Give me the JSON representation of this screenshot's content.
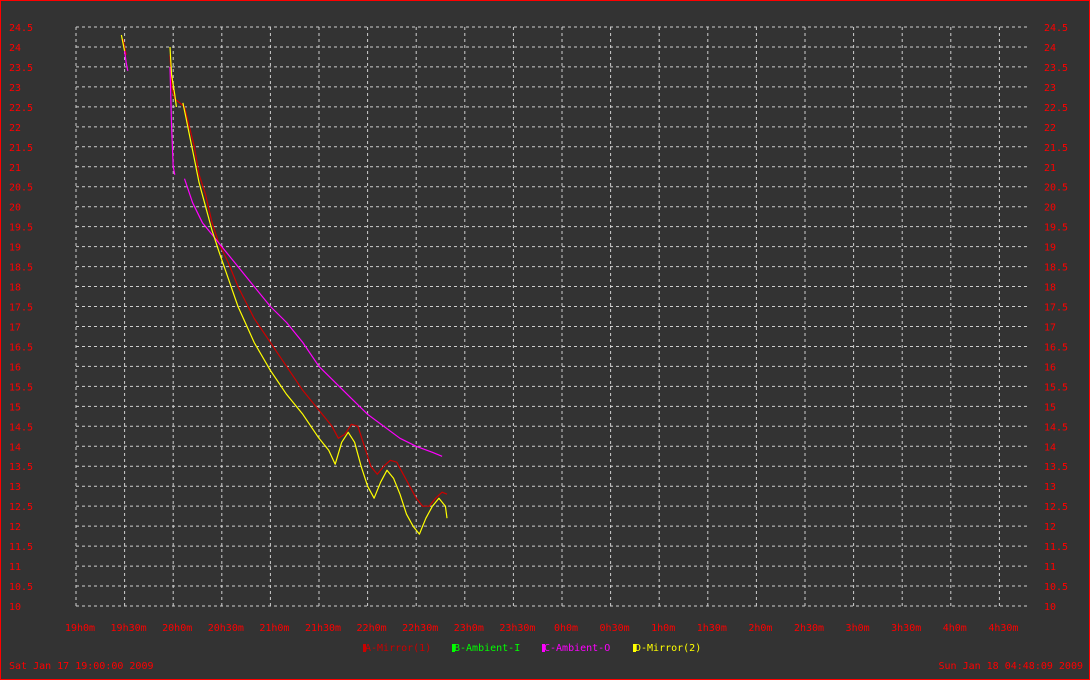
{
  "chart_data": {
    "type": "line",
    "y_ticks": [
      "24.5",
      "24",
      "23.5",
      "23",
      "22.5",
      "22",
      "21.5",
      "21",
      "20.5",
      "20",
      "19.5",
      "19",
      "18.5",
      "18",
      "17.5",
      "17",
      "16.5",
      "16",
      "15.5",
      "15",
      "14.5",
      "14",
      "13.5",
      "13",
      "12.5",
      "12",
      "11.5",
      "11",
      "10.5",
      "10"
    ],
    "x_ticks": [
      "19h0m",
      "19h30m",
      "20h0m",
      "20h30m",
      "21h0m",
      "21h30m",
      "22h0m",
      "22h30m",
      "23h0m",
      "23h30m",
      "0h0m",
      "0h30m",
      "1h0m",
      "1h30m",
      "2h0m",
      "2h30m",
      "3h0m",
      "3h30m",
      "4h0m",
      "4h30m"
    ],
    "ylim": [
      10,
      24.5
    ],
    "xlim_minutes": [
      0,
      588
    ],
    "x_unit": "minutes after Sat Jan 17 19:00:00 2009",
    "grid": true,
    "legend_position": "bottom-center",
    "start_label": "Sat Jan 17 19:00:00 2009",
    "end_label": "Sun Jan 18 04:48:09 2009",
    "series": [
      {
        "name": "A-Mirror(1)",
        "color": "#cc0000",
        "segments": [
          [
            [
              29,
              24.2
            ],
            [
              30,
              24.0
            ],
            [
              31,
              23.8
            ]
          ],
          [
            [
              58,
              23.8
            ],
            [
              59,
              23.0
            ],
            [
              61,
              22.7
            ],
            [
              64,
              22.6
            ],
            [
              67,
              22.5
            ],
            [
              70,
              22.0
            ],
            [
              73,
              21.5
            ],
            [
              76,
              20.8
            ],
            [
              80,
              20.3
            ],
            [
              84,
              19.6
            ],
            [
              88,
              19.1
            ],
            [
              94,
              18.6
            ],
            [
              100,
              18.0
            ],
            [
              110,
              17.2
            ],
            [
              120,
              16.6
            ],
            [
              130,
              16.0
            ],
            [
              140,
              15.4
            ],
            [
              150,
              14.9
            ],
            [
              158,
              14.5
            ],
            [
              162,
              14.2
            ],
            [
              166,
              14.3
            ],
            [
              170,
              14.55
            ],
            [
              174,
              14.5
            ],
            [
              178,
              14.0
            ],
            [
              182,
              13.5
            ],
            [
              186,
              13.3
            ],
            [
              190,
              13.5
            ],
            [
              194,
              13.65
            ],
            [
              198,
              13.6
            ],
            [
              202,
              13.3
            ],
            [
              206,
              13.0
            ],
            [
              210,
              12.7
            ],
            [
              214,
              12.5
            ],
            [
              218,
              12.5
            ],
            [
              222,
              12.7
            ],
            [
              226,
              12.85
            ],
            [
              229,
              12.8
            ]
          ]
        ]
      },
      {
        "name": "B-Ambient-I",
        "color": "#00ff00",
        "segments": []
      },
      {
        "name": "C-Ambient-O",
        "color": "#ff00ff",
        "segments": [
          [
            [
              30,
              23.9
            ],
            [
              31,
              23.6
            ],
            [
              32,
              23.4
            ]
          ],
          [
            [
              58,
              23.5
            ],
            [
              59,
              22.0
            ],
            [
              60,
              21.0
            ],
            [
              61,
              20.8
            ]
          ],
          [
            [
              67,
              20.7
            ],
            [
              72,
              20.1
            ],
            [
              78,
              19.6
            ],
            [
              84,
              19.3
            ],
            [
              92,
              18.9
            ],
            [
              100,
              18.5
            ],
            [
              110,
              18.0
            ],
            [
              120,
              17.5
            ],
            [
              130,
              17.1
            ],
            [
              140,
              16.6
            ],
            [
              150,
              16.0
            ],
            [
              160,
              15.6
            ],
            [
              170,
              15.2
            ],
            [
              180,
              14.8
            ],
            [
              190,
              14.5
            ],
            [
              200,
              14.2
            ],
            [
              210,
              14.0
            ],
            [
              220,
              13.85
            ],
            [
              226,
              13.75
            ]
          ]
        ]
      },
      {
        "name": "D-Mirror(2)",
        "color": "#ffff00",
        "segments": [
          [
            [
              28,
              24.3
            ],
            [
              29,
              24.1
            ],
            [
              30,
              23.9
            ]
          ],
          [
            [
              58,
              24.0
            ],
            [
              59,
              23.3
            ],
            [
              61,
              22.8
            ],
            [
              62,
              22.5
            ]
          ],
          [
            [
              66,
              22.6
            ],
            [
              68,
              22.2
            ],
            [
              70,
              21.8
            ],
            [
              73,
              21.2
            ],
            [
              76,
              20.6
            ],
            [
              80,
              20.0
            ],
            [
              84,
              19.4
            ],
            [
              88,
              18.9
            ],
            [
              94,
              18.2
            ],
            [
              100,
              17.5
            ],
            [
              110,
              16.6
            ],
            [
              120,
              15.9
            ],
            [
              130,
              15.3
            ],
            [
              140,
              14.8
            ],
            [
              150,
              14.2
            ],
            [
              156,
              13.9
            ],
            [
              160,
              13.55
            ],
            [
              164,
              14.1
            ],
            [
              168,
              14.35
            ],
            [
              172,
              14.1
            ],
            [
              176,
              13.5
            ],
            [
              180,
              13.0
            ],
            [
              184,
              12.7
            ],
            [
              188,
              13.1
            ],
            [
              192,
              13.4
            ],
            [
              196,
              13.2
            ],
            [
              200,
              12.8
            ],
            [
              204,
              12.3
            ],
            [
              208,
              12.0
            ],
            [
              212,
              11.8
            ],
            [
              216,
              12.2
            ],
            [
              220,
              12.5
            ],
            [
              224,
              12.7
            ],
            [
              228,
              12.5
            ],
            [
              229,
              12.2
            ]
          ]
        ]
      }
    ]
  }
}
